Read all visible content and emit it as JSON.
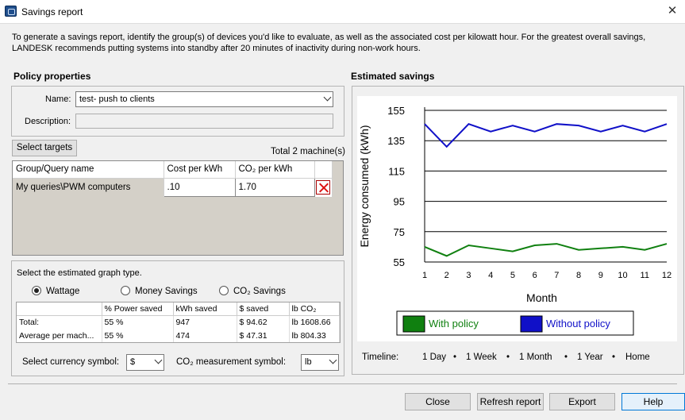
{
  "window": {
    "title": "Savings report",
    "close_glyph": "✕"
  },
  "intro": "To generate a savings report, identify the group(s) of devices you'd like to evaluate, as well as the associated cost per kilowatt hour. For the greatest overall savings, LANDESK recommends putting systems into standby after 20 minutes of inactivity during non-work hours.",
  "policy": {
    "section_title": "Policy properties",
    "name_label": "Name:",
    "name_value": "test- push to clients",
    "description_label": "Description:",
    "description_value": ""
  },
  "targets": {
    "select_button": "Select targets",
    "total": "Total 2 machine(s)",
    "headers": [
      "Group/Query name",
      "Cost per kWh",
      "CO₂ per kWh"
    ],
    "rows": [
      {
        "name": "My queries\\PWM computers",
        "cost": ".10",
        "co2": "1.70"
      }
    ]
  },
  "graph_type": {
    "label": "Select the estimated graph type.",
    "options": [
      "Wattage",
      "Money Savings",
      "CO₂ Savings"
    ],
    "selected": "Wattage"
  },
  "summary": {
    "headers": [
      "",
      "% Power saved",
      "kWh saved",
      "$ saved",
      "lb CO₂"
    ],
    "rows": [
      [
        "Total:",
        "55 %",
        "947",
        "$ 94.62",
        "lb 1608.66"
      ],
      [
        "Average per mach...",
        "55 %",
        "474",
        "$ 47.31",
        "lb 804.33"
      ]
    ]
  },
  "currency": {
    "label": "Select currency symbol:",
    "value": "$",
    "co2_label": "CO₂ measurement symbol:",
    "co2_value": "lb"
  },
  "estimated": {
    "section_title": "Estimated savings"
  },
  "chart_data": {
    "type": "line",
    "x": [
      1,
      2,
      3,
      4,
      5,
      6,
      7,
      8,
      9,
      10,
      11,
      12
    ],
    "xlabel": "Month",
    "ylabel": "Energy consumed (kWh)",
    "ylim": [
      55,
      155
    ],
    "yticks": [
      55,
      75,
      95,
      115,
      135,
      155
    ],
    "grid": true,
    "legend_position": "bottom",
    "series": [
      {
        "name": "With policy",
        "color": "#108010",
        "values": [
          65,
          59,
          66,
          64,
          62,
          66,
          67,
          63,
          64,
          65,
          63,
          67
        ]
      },
      {
        "name": "Without policy",
        "color": "#1010c8",
        "values": [
          146,
          131,
          146,
          141,
          145,
          141,
          146,
          145,
          141,
          145,
          141,
          146
        ]
      }
    ]
  },
  "timeline": {
    "label": "Timeline:",
    "options": [
      "1 Day",
      "1 Week",
      "1 Month",
      "1 Year",
      "Home"
    ],
    "separator": "•",
    "active": "1 Year"
  },
  "buttons": {
    "close": "Close",
    "refresh": "Refresh report",
    "export": "Export",
    "help": "Help"
  }
}
